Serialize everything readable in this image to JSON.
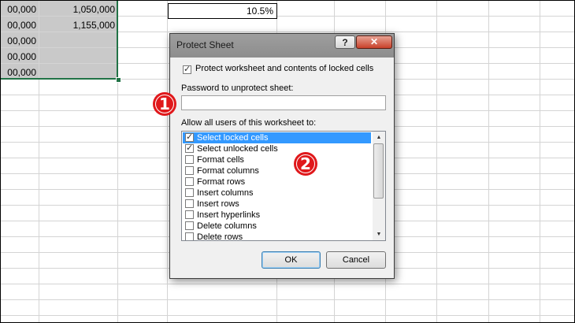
{
  "sheet": {
    "rows": [
      {
        "a": "00,000",
        "b": "1,050,000"
      },
      {
        "a": "00,000",
        "b": "1,155,000"
      },
      {
        "a": "00,000",
        "b": ""
      },
      {
        "a": "00,000",
        "b": ""
      },
      {
        "a": "00,000",
        "b": ""
      }
    ],
    "percent_cell": "10.5%"
  },
  "dialog": {
    "title": "Protect Sheet",
    "help_label": "?",
    "close_label": "✕",
    "protect_checkbox_label": "Protect worksheet and contents of locked cells",
    "protect_checked": true,
    "password_label": "Password to unprotect sheet:",
    "password_value": "",
    "allow_label": "Allow all users of this worksheet to:",
    "permissions": [
      {
        "label": "Select locked cells",
        "checked": true
      },
      {
        "label": "Select unlocked cells",
        "checked": true
      },
      {
        "label": "Format cells",
        "checked": false
      },
      {
        "label": "Format columns",
        "checked": false
      },
      {
        "label": "Format rows",
        "checked": false
      },
      {
        "label": "Insert columns",
        "checked": false
      },
      {
        "label": "Insert rows",
        "checked": false
      },
      {
        "label": "Insert hyperlinks",
        "checked": false
      },
      {
        "label": "Delete columns",
        "checked": false
      },
      {
        "label": "Delete rows",
        "checked": false
      }
    ],
    "ok_label": "OK",
    "cancel_label": "Cancel"
  },
  "badges": {
    "one": "1",
    "two": "2"
  },
  "colors": {
    "badge": "#e0181b",
    "selection": "#217346",
    "highlight": "#3399ff"
  }
}
